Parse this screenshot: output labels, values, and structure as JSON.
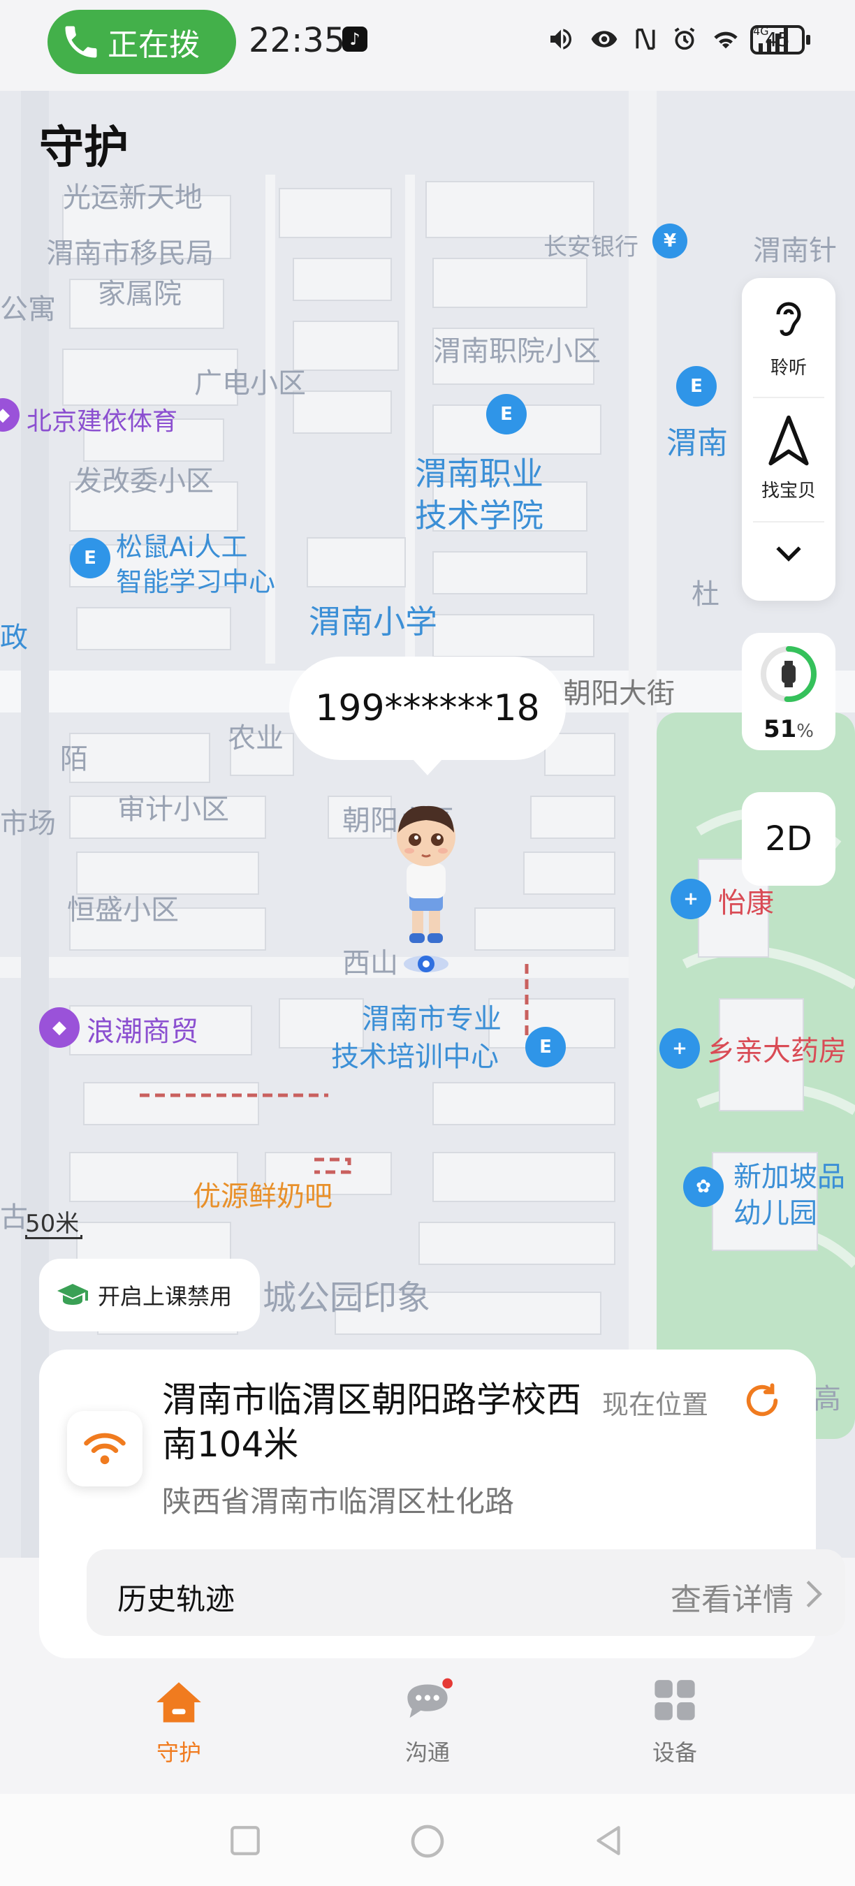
{
  "status_bar": {
    "call_label": "正在拨",
    "time": "22:35",
    "network": "4G",
    "battery": "45"
  },
  "header": {
    "title": "守护"
  },
  "map": {
    "labels": {
      "guangyun": "光运新天地",
      "yimin": "渭南市移民局",
      "jiashu": "家属院",
      "gongyu": "公寓",
      "changan_bank": "长安银行",
      "weinan_zhen": "渭南针",
      "guangdian": "广电小区",
      "zhiyuan_xiaoqu": "渭南职院小区",
      "beijing_jianyi": "北京建依体育",
      "fagaiwei": "发改委小区",
      "zhiye_line1": "渭南职业",
      "zhiye_line2": "技术学院",
      "weinan_cut": "渭南",
      "songshu_line1": "松鼠Ai人工",
      "songshu_line2": "智能学习中心",
      "weinan_xiaoxue": "渭南小学",
      "zheng": "政",
      "duhua": "杜",
      "chaoyang_street": "朝阳大街",
      "nongye": "农业",
      "mo": "陌",
      "shenji": "审计小区",
      "chaoyang_xiaoqu": "朝阳小区",
      "shichang": "市场",
      "hengsheng": "恒盛小区",
      "yikang": "怡康",
      "xishan": "西山",
      "langchao": "浪潮商贸",
      "peixun_line1": "渭南市专业",
      "peixun_line2": "技术培训中心",
      "xiangqin": "乡亲大药房",
      "xinjiapo_line1": "新加坡品",
      "xinjiapo_line2": "幼儿园",
      "youyuan": "优源鲜奶吧",
      "gu": "古",
      "chenggongyuan": "城公园印象",
      "gao": "高"
    },
    "phone_bubble": "199******18",
    "scale": "50米"
  },
  "tools": {
    "listen": "聆听",
    "find_baby": "找宝贝",
    "battery_pct": "51",
    "battery_unit": "%",
    "view_mode": "2D"
  },
  "class_mode_button": "开启上课禁用",
  "location_card": {
    "title": "渭南市临渭区朝阳路学校西南104米",
    "current_position": "现在位置",
    "address": "陕西省渭南市临渭区杜化路",
    "history_label": "历史轨迹",
    "history_action": "查看详情"
  },
  "tab_bar": {
    "tabs": [
      {
        "label": "守护",
        "active": true
      },
      {
        "label": "沟通",
        "active": false
      },
      {
        "label": "设备",
        "active": false
      }
    ],
    "active_color": "#f07b1f"
  },
  "colors": {
    "accent": "#f07b1f",
    "call_green": "#43b04a",
    "poi_blue": "#2f95e8",
    "park_green": "#bfe3c6"
  }
}
